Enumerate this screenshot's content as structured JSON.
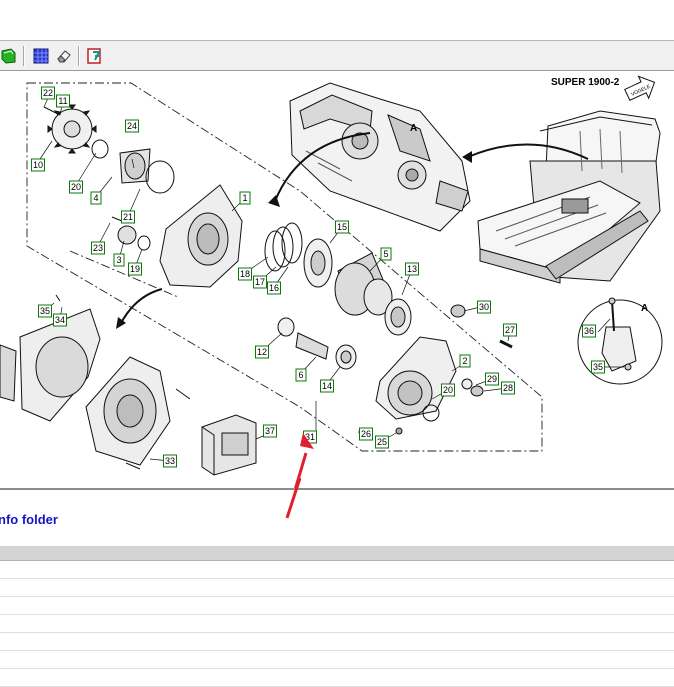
{
  "toolbar": {
    "buttons": [
      {
        "name": "green-book-icon",
        "color": "#1e9e1e"
      },
      {
        "name": "blue-grid-icon",
        "color": "#2030c0"
      },
      {
        "name": "eraser-icon",
        "color": "#707070"
      },
      {
        "name": "report-icon",
        "color": "#c02020"
      }
    ]
  },
  "drawing": {
    "model": "SUPER 1900-2",
    "detail_label": "A",
    "inset_label": "A",
    "part_tags": [
      "1",
      "2",
      "3",
      "4",
      "5",
      "6",
      "10",
      "11",
      "12",
      "13",
      "14",
      "15",
      "16",
      "17",
      "18",
      "19",
      "20",
      "21",
      "22",
      "23",
      "24",
      "25",
      "26",
      "27",
      "28",
      "29",
      "30",
      "31",
      "33",
      "34",
      "35",
      "36",
      "37"
    ]
  },
  "info_folder": {
    "label": "nfo folder"
  },
  "grid": {
    "header_color": "#d4d4d4",
    "rows": 7
  },
  "colors": {
    "tag_border": "#0a7a0a",
    "link": "#1414c8",
    "arrow": "#e02030"
  }
}
